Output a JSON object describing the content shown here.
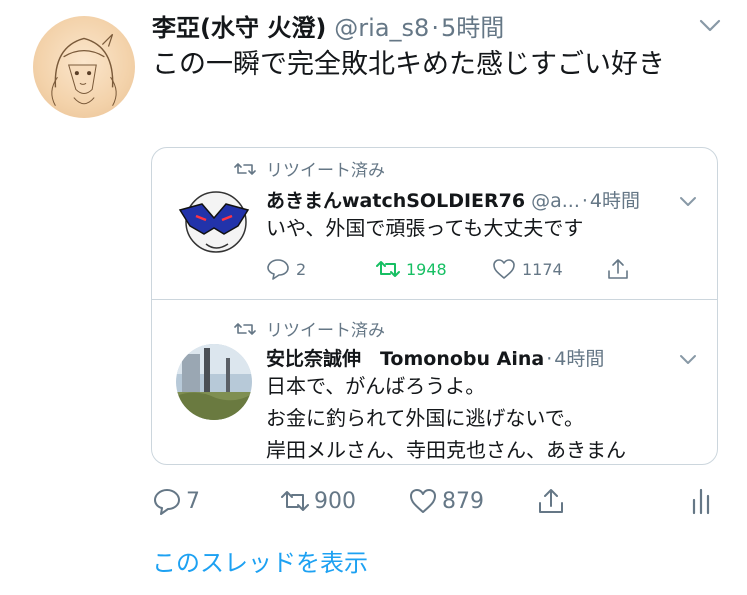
{
  "tweet": {
    "author_name": "李亞(水守 火澄)",
    "author_handle": "@ria_s8",
    "separator": "·",
    "time": "5時間",
    "text": "この一瞬で完全敗北キめた感じすごい好き",
    "actions": {
      "replies": "7",
      "retweets": "900",
      "likes": "879"
    },
    "thread_link": "このスレッドを表示"
  },
  "quote": {
    "items": [
      {
        "retweeted_label": "リツイート済み",
        "author_name": "あきまんwatchSOLDIER76",
        "author_handle": "@a...",
        "separator": "·",
        "time": "4時間",
        "text": "いや、外国で頑張っても大丈夫です",
        "actions": {
          "replies": "2",
          "retweets": "1948",
          "likes": "1174"
        }
      },
      {
        "retweeted_label": "リツイート済み",
        "author_name": "安比奈誠伸　Tomonobu Aina",
        "separator": "·",
        "time": "4時間",
        "text_lines": [
          "日本で、がんばろうよ。",
          "お金に釣られて外国に逃げないで。",
          "岸田メルさん、寺田克也さん、あきまん"
        ]
      }
    ]
  },
  "icons": {
    "reply": "reply-icon",
    "retweet": "retweet-icon",
    "like": "heart-icon",
    "share": "share-icon",
    "analytics": "analytics-icon",
    "more": "chevron-down-icon"
  },
  "colors": {
    "text": "#14171a",
    "secondary": "#657786",
    "link": "#1da1f2",
    "retweet_active": "#17bf63",
    "border": "#ccd6dd"
  }
}
